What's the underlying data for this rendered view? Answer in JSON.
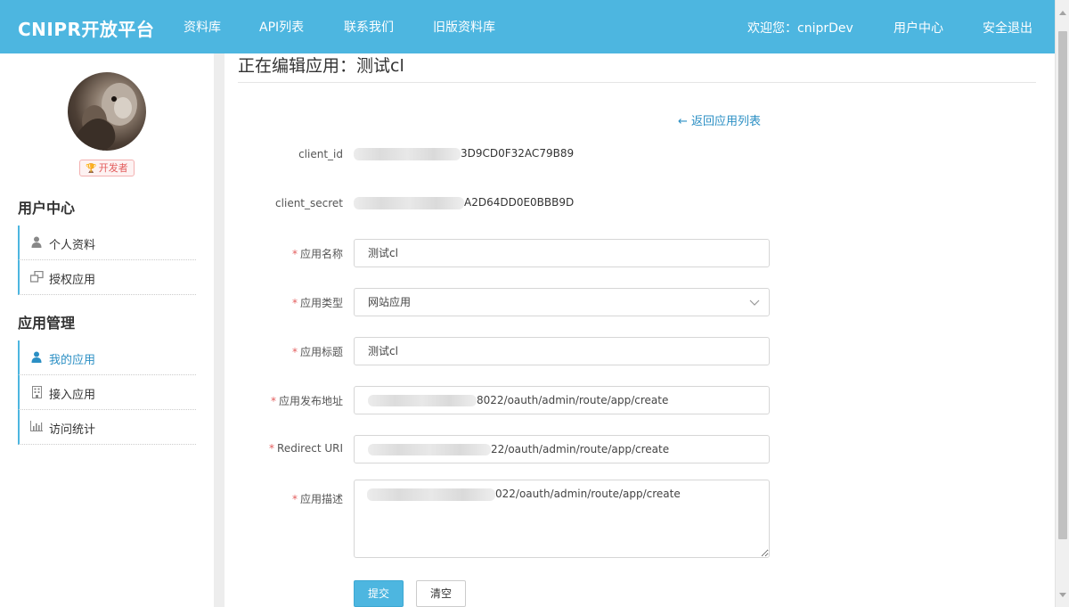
{
  "header": {
    "brand": "CNIPR开放平台",
    "nav": [
      "资料库",
      "API列表",
      "联系我们",
      "旧版资料库"
    ],
    "welcome": "欢迎您：cniprDev",
    "user_center": "用户中心",
    "logout": "安全退出"
  },
  "sidebar": {
    "badge": "开发者",
    "badge_icon": "trophy-icon",
    "sections": [
      {
        "title": "用户中心",
        "items": [
          {
            "label": "个人资料",
            "icon": "user-icon",
            "active": false
          },
          {
            "label": "授权应用",
            "icon": "windows-icon",
            "active": false
          }
        ]
      },
      {
        "title": "应用管理",
        "items": [
          {
            "label": "我的应用",
            "icon": "user-icon",
            "active": true
          },
          {
            "label": "接入应用",
            "icon": "building-icon",
            "active": false
          },
          {
            "label": "访问统计",
            "icon": "bar-chart-icon",
            "active": false
          }
        ]
      }
    ]
  },
  "page": {
    "title": "正在编辑应用：测试cl",
    "back_link": "返回应用列表",
    "back_icon": "arrow-left-icon"
  },
  "form": {
    "client_id": {
      "label": "client_id",
      "value_visible": "3D9CD0F32AC79B89"
    },
    "client_secret": {
      "label": "client_secret",
      "value_visible": "A2D64DD0E0BBB9D"
    },
    "app_name": {
      "label": "应用名称",
      "value": "测试cl",
      "required": true
    },
    "app_type": {
      "label": "应用类型",
      "value": "网站应用",
      "required": true
    },
    "app_title": {
      "label": "应用标题",
      "value": "测试cl",
      "required": true
    },
    "publish_url": {
      "label": "应用发布地址",
      "value_visible": "8022/oauth/admin/route/app/create",
      "required": true
    },
    "redirect_uri": {
      "label": "Redirect URI",
      "value_visible": "22/oauth/admin/route/app/create",
      "required": true
    },
    "description": {
      "label": "应用描述",
      "value_visible": "022/oauth/admin/route/app/create",
      "required": true
    },
    "submit": "提交",
    "clear": "清空"
  },
  "colors": {
    "accent": "#4db6e0",
    "link": "#2b8fc4",
    "required": "#e35d5d"
  }
}
